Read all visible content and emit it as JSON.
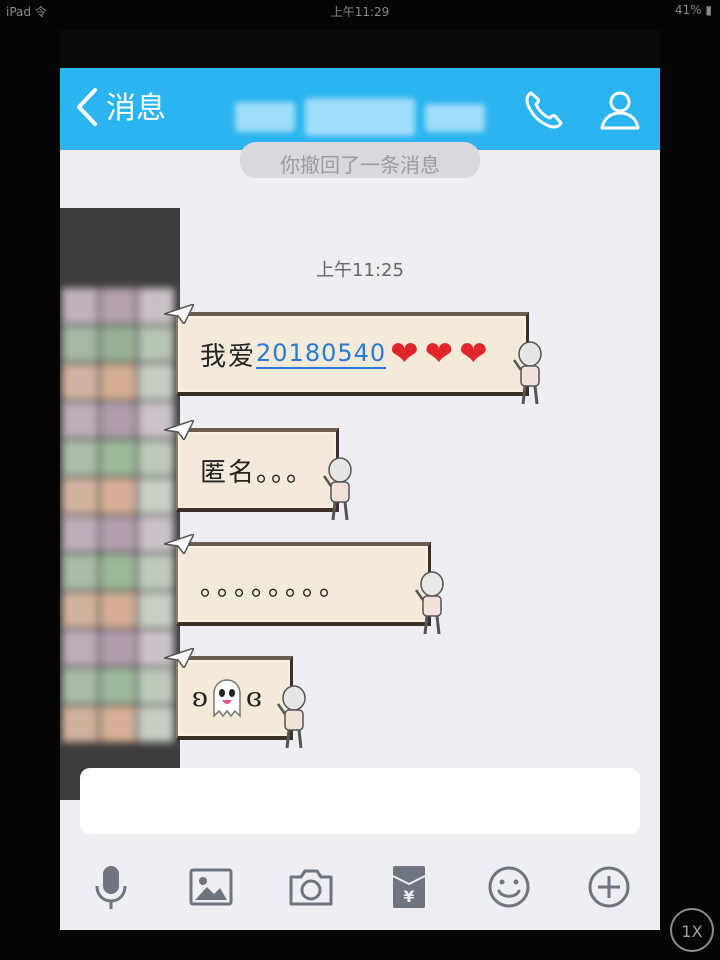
{
  "status_bar": {
    "left": "iPad 令",
    "center": "上午11:29",
    "right": "41% ▮"
  },
  "nav": {
    "back_label": "消息",
    "icons": [
      "chevron-left-icon",
      "phone-icon",
      "profile-icon"
    ]
  },
  "notice": {
    "text": "你撤回了一条消息"
  },
  "chat": {
    "timestamp": "上午11:25",
    "messages": [
      {
        "prefix": "我爱",
        "link": "20180540",
        "hearts": "❤❤❤"
      },
      {
        "text": "匿名。。。"
      },
      {
        "text": "。。。。。。。。"
      },
      {
        "left": "ʚ",
        "emoji": "ghost-icon",
        "right": "ɞ"
      }
    ]
  },
  "input": {
    "placeholder": ""
  },
  "toolbar": {
    "icons": [
      "microphone-icon",
      "image-icon",
      "camera-icon",
      "red-packet-icon",
      "emoji-icon",
      "plus-icon"
    ]
  },
  "zoom": {
    "label": "1X"
  },
  "colors": {
    "nav_bar": "#2bb4ef",
    "chat_bg": "#eeeef3",
    "link": "#2a7ad4",
    "heart": "#e0262b",
    "icon_gray": "#6e7480"
  }
}
